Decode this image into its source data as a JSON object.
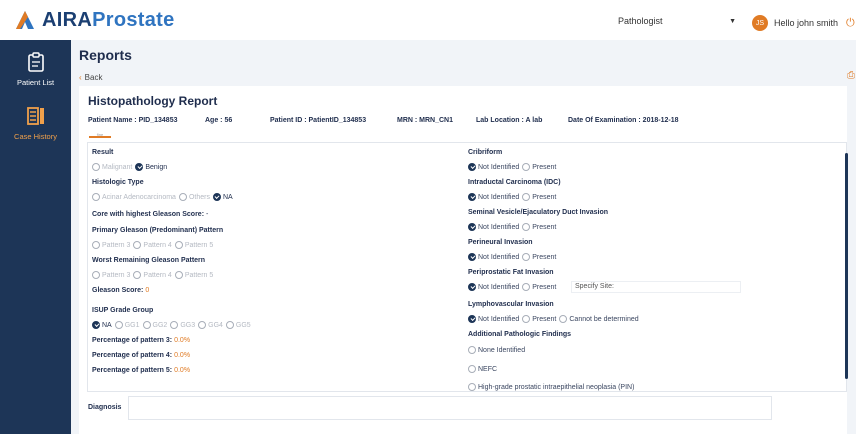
{
  "app": {
    "logo_part1": "AIRA",
    "logo_part2": "Prostate"
  },
  "header": {
    "role_selected": "Pathologist",
    "avatar_initials": "JS",
    "greeting": "Hello john smith"
  },
  "sidebar": {
    "items": [
      {
        "label": "Patient List",
        "active": false
      },
      {
        "label": "Case History",
        "active": true
      }
    ]
  },
  "page": {
    "title": "Reports",
    "back_label": "Back"
  },
  "report": {
    "title": "Histopathology Report",
    "patient_name": "Patient Name : PID_134853",
    "age": "Age : 56",
    "patient_id": "Patient ID : PatientID_134853",
    "mrn": "MRN : MRN_CN1",
    "lab_location": "Lab Location : A lab",
    "date_of_exam": "Date Of Examination : 2018-12-18",
    "tab_label": "fine"
  },
  "left": {
    "result": {
      "label": "Result",
      "options": [
        "Malignant",
        "Benign"
      ],
      "selected": 1
    },
    "histologic_type": {
      "label": "Histologic Type",
      "options": [
        "Acinar Adenocarcinoma",
        "Others",
        "NA"
      ],
      "selected": 2
    },
    "core_label": "Core with highest Gleason Score:",
    "core_value": "-",
    "primary_gleason": {
      "label": "Primary Gleason (Predominant) Pattern",
      "options": [
        "Pattern 3",
        "Pattern 4",
        "Pattern 5"
      ]
    },
    "worst_gleason": {
      "label": "Worst Remaining Gleason Pattern",
      "options": [
        "Pattern 3",
        "Pattern 4",
        "Pattern 5"
      ]
    },
    "gleason_score_label": "Gleason Score:",
    "gleason_score_value": "0",
    "isup": {
      "label": "ISUP Grade Group",
      "options": [
        "NA",
        "GG1",
        "GG2",
        "GG3",
        "GG4",
        "GG5"
      ],
      "selected": 0
    },
    "pattern3_label": "Percentage of pattern 3:",
    "pattern3_value": "0.0%",
    "pattern4_label": "Percentage of pattern 4:",
    "pattern4_value": "0.0%",
    "pattern5_label": "Percentage of pattern 5:",
    "pattern5_value": "0.0%"
  },
  "right": {
    "cribriform": {
      "label": "Cribriform",
      "options": [
        "Not Identified",
        "Present"
      ],
      "selected": 0
    },
    "idc": {
      "label": "Intraductal Carcinoma (IDC)",
      "options": [
        "Not Identified",
        "Present"
      ],
      "selected": 0
    },
    "seminal": {
      "label": "Seminal Vesicle/Ejaculatory Duct Invasion",
      "options": [
        "Not Identified",
        "Present"
      ],
      "selected": 0
    },
    "perineural": {
      "label": "Perineural Invasion",
      "options": [
        "Not Identified",
        "Present"
      ],
      "selected": 0
    },
    "periprostatic": {
      "label": "Periprostatic Fat Invasion",
      "options": [
        "Not Identified",
        "Present"
      ],
      "selected": 0,
      "specify_placeholder": "Specify Site:"
    },
    "lymphovascular": {
      "label": "Lymphovascular Invasion",
      "options": [
        "Not Identified",
        "Present",
        "Cannot be determined"
      ],
      "selected": 0
    },
    "additional": {
      "label": "Additional Pathologic Findings",
      "options": [
        "None Identified",
        "NEFC",
        "High-grade prostatic intraepithelial neoplasia (PIN)"
      ]
    }
  },
  "diagnosis": {
    "label": "Diagnosis",
    "value": ""
  },
  "colors": {
    "accent": "#e07b25",
    "navy": "#1d3557",
    "bg": "#f1f4f8"
  }
}
